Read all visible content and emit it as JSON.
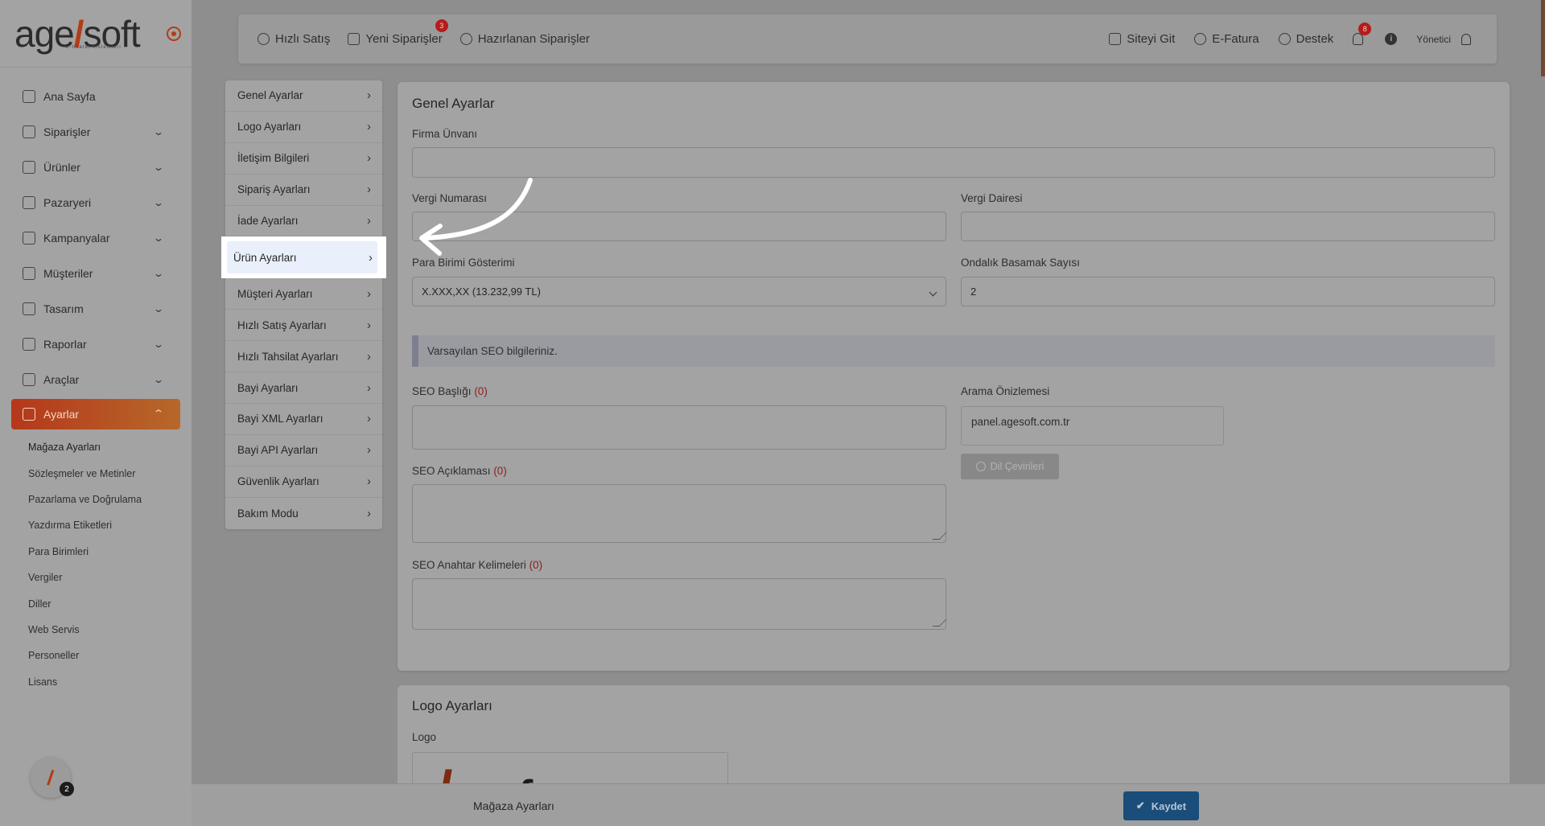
{
  "brand": {
    "logo_left": "age",
    "logo_slash": "/",
    "logo_right": "soft",
    "tagline": "e-ticaret sistemleri",
    "accent": "#b43b17"
  },
  "sidebar": {
    "items": [
      {
        "label": "Ana Sayfa",
        "icon": "home-icon",
        "has_children": false
      },
      {
        "label": "Siparişler",
        "icon": "cart-icon",
        "has_children": true
      },
      {
        "label": "Ürünler",
        "icon": "book-icon",
        "has_children": true
      },
      {
        "label": "Pazaryeri",
        "icon": "box-icon",
        "has_children": true
      },
      {
        "label": "Kampanyalar",
        "icon": "gift-icon",
        "has_children": true
      },
      {
        "label": "Müşteriler",
        "icon": "user-icon",
        "has_children": true
      },
      {
        "label": "Tasarım",
        "icon": "brush-icon",
        "has_children": true
      },
      {
        "label": "Raporlar",
        "icon": "chart-icon",
        "has_children": true
      },
      {
        "label": "Araçlar",
        "icon": "clipboard-icon",
        "has_children": true
      },
      {
        "label": "Ayarlar",
        "icon": "gear-icon",
        "has_children": true,
        "active": true
      }
    ],
    "submenu": [
      "Mağaza Ayarları",
      "Sözleşmeler ve Metinler",
      "Pazarlama ve Doğrulama",
      "Yazdırma Etiketleri",
      "Para Birimleri",
      "Vergiler",
      "Diller",
      "Web Servis",
      "Personeller",
      "Lisans"
    ],
    "help_count": "2"
  },
  "topbar": {
    "quick_sale": "Hızlı Satış",
    "new_orders": "Yeni Siparişler",
    "new_orders_badge": "3",
    "preparing_orders": "Hazırlanan Siparişler",
    "visit_site": "Siteyi Git",
    "einvoice": "E-Fatura",
    "support": "Destek",
    "notif_badge": "8",
    "user": "Yönetici"
  },
  "settings_nav": [
    "Genel Ayarlar",
    "Logo Ayarları",
    "İletişim Bilgileri",
    "Sipariş Ayarları",
    "İade Ayarları",
    "Ürün Ayarları",
    "Müşteri Ayarları",
    "Hızlı Satış Ayarları",
    "Hızlı Tahsilat Ayarları",
    "Bayi Ayarları",
    "Bayi XML Ayarları",
    "Bayi API Ayarları",
    "Güvenlik Ayarları",
    "Bakım Modu"
  ],
  "general": {
    "title": "Genel Ayarlar",
    "company_label": "Firma Ünvanı",
    "company_value": "",
    "tax_no_label": "Vergi Numarası",
    "tax_no_value": "",
    "tax_office_label": "Vergi Dairesi",
    "tax_office_value": "",
    "currency_label": "Para Birimi Gösterimi",
    "currency_value": "X.XXX,XX (13.232,99 TL)",
    "decimals_label": "Ondalık Basamak Sayısı",
    "decimals_value": "2",
    "seo_info": "Varsayılan SEO bilgileriniz.",
    "seo_title_label": "SEO Başlığı",
    "seo_title_count": "(0)",
    "seo_desc_label": "SEO Açıklaması",
    "seo_desc_count": "(0)",
    "seo_keywords_label": "SEO Anahtar Kelimeleri",
    "seo_keywords_count": "(0)",
    "preview_label": "Arama Önizlemesi",
    "preview_url": "panel.agesoft.com.tr",
    "lang_button": "Dil Çevirileri"
  },
  "logo_section": {
    "title": "Logo Ayarları",
    "logo_label": "Logo"
  },
  "footer": {
    "title": "Mağaza Ayarları",
    "save": "Kaydet"
  }
}
